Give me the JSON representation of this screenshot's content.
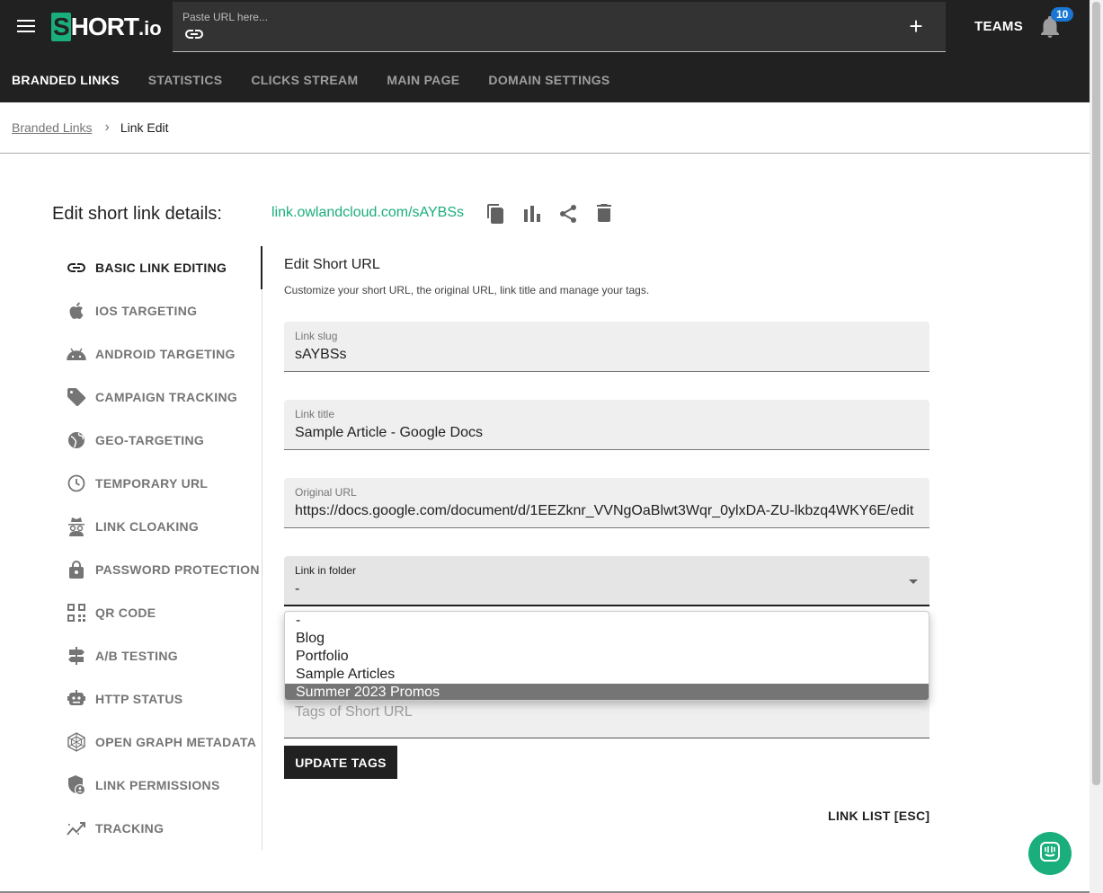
{
  "app": {
    "logo_text": "SHORT",
    "logo_suffix": ".io",
    "url_placeholder": "Paste URL here...",
    "teams_label": "TEAMS",
    "notification_count": "10",
    "brand_color": "#1aae7c"
  },
  "nav_tabs": [
    {
      "label": "BRANDED LINKS",
      "active": true
    },
    {
      "label": "STATISTICS",
      "active": false
    },
    {
      "label": "CLICKS STREAM",
      "active": false
    },
    {
      "label": "MAIN PAGE",
      "active": false
    },
    {
      "label": "DOMAIN SETTINGS",
      "active": false
    }
  ],
  "breadcrumb": {
    "parent": "Branded Links",
    "current": "Link Edit"
  },
  "header": {
    "title": "Edit short link details:",
    "short_link": "link.owlandcloud.com/sAYBSs",
    "actions": [
      "copy-icon",
      "bar-chart-icon",
      "share-icon",
      "delete-icon"
    ]
  },
  "side_menu": [
    {
      "label": "BASIC LINK EDITING",
      "icon": "link-icon",
      "active": true
    },
    {
      "label": "IOS TARGETING",
      "icon": "apple-icon"
    },
    {
      "label": "ANDROID TARGETING",
      "icon": "android-icon"
    },
    {
      "label": "CAMPAIGN TRACKING",
      "icon": "tag-icon"
    },
    {
      "label": "GEO-TARGETING",
      "icon": "globe-icon"
    },
    {
      "label": "TEMPORARY URL",
      "icon": "clock-icon"
    },
    {
      "label": "LINK CLOAKING",
      "icon": "spy-icon"
    },
    {
      "label": "PASSWORD PROTECTION",
      "icon": "lock-icon"
    },
    {
      "label": "QR CODE",
      "icon": "qr-code-icon"
    },
    {
      "label": "A/B TESTING",
      "icon": "signpost-icon"
    },
    {
      "label": "HTTP STATUS",
      "icon": "robot-icon"
    },
    {
      "label": "OPEN GRAPH METADATA",
      "icon": "web-icon"
    },
    {
      "label": "LINK PERMISSIONS",
      "icon": "shield-user-icon"
    },
    {
      "label": "TRACKING",
      "icon": "trending-icon"
    }
  ],
  "form": {
    "title": "Edit Short URL",
    "description": "Customize your short URL, the original URL, link title and manage your tags.",
    "slug_label": "Link slug",
    "slug_value": "sAYBSs",
    "title_label": "Link title",
    "title_value": "Sample Article - Google Docs",
    "original_label": "Original URL",
    "original_value": "https://docs.google.com/document/d/1EEZknr_VVNgOaBlwt3Wqr_0ylxDA-ZU-lkbzq4WKY6E/edit",
    "folder_label": "Link in folder",
    "folder_value": "-",
    "folder_options": [
      "-",
      "Blog",
      "Portfolio",
      "Sample Articles",
      "Summer 2023 Promos"
    ],
    "highlighted_option": "Summer 2023 Promos",
    "tags_placeholder": "Tags of Short URL",
    "update_tags_label": "UPDATE TAGS",
    "link_list_label": "LINK LIST [ESC]"
  }
}
